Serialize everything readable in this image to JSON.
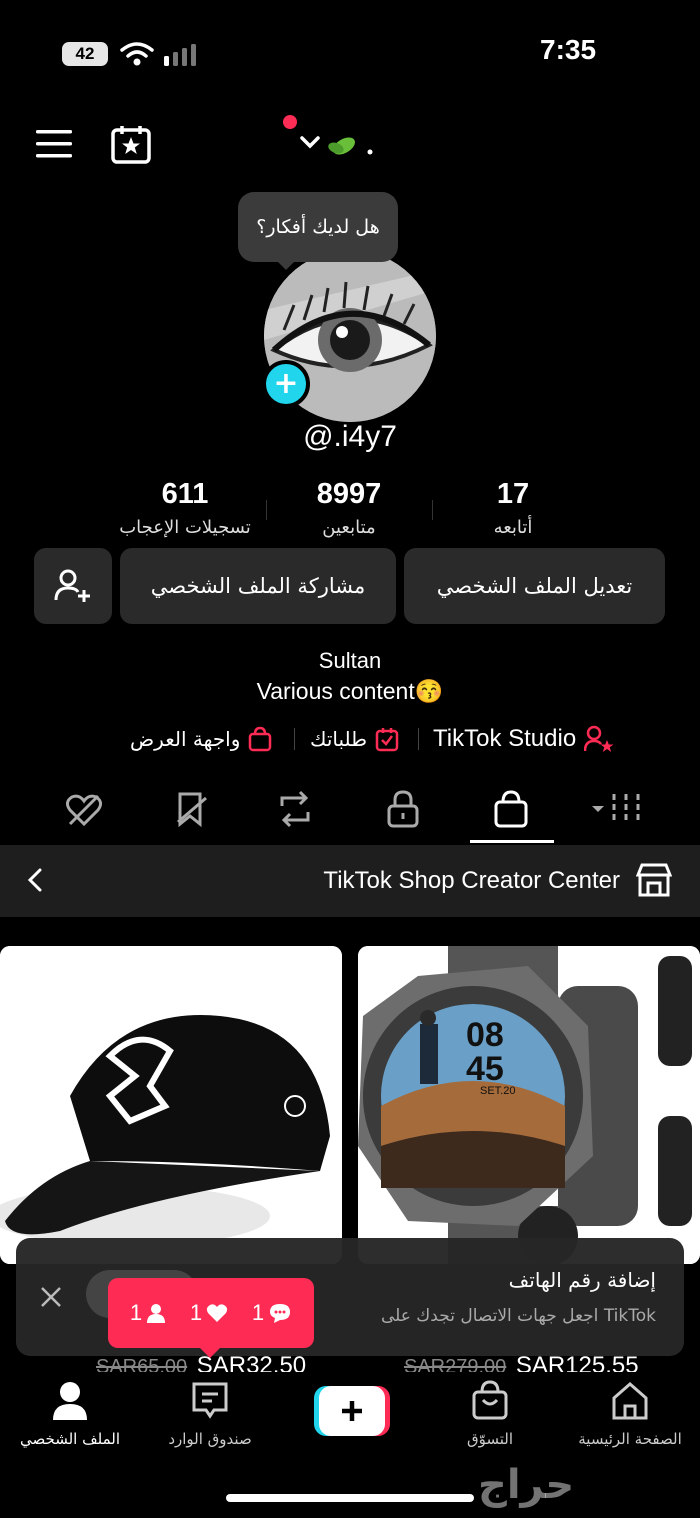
{
  "status_bar": {
    "time": "7:35",
    "battery": "42"
  },
  "profile": {
    "username_menu_label": "",
    "tooltip": "هل لديك أفكار؟",
    "handle": "@.i4y7",
    "stats": [
      {
        "value": "611",
        "label": "تسجيلات الإعجاب"
      },
      {
        "value": "8997",
        "label": "متابعين"
      },
      {
        "value": "17",
        "label": "أتابعه"
      }
    ],
    "buttons": {
      "share": "مشاركة الملف الشخصي",
      "edit": "تعديل الملف الشخصي"
    },
    "bio": {
      "name": "Sultan",
      "line2": "Various content😚"
    },
    "links": {
      "storefront": "واجهة العرض",
      "orders": "طلباتك",
      "studio": "TikTok Studio"
    }
  },
  "tabs": [
    "liked-hidden",
    "favorites",
    "reposts",
    "private",
    "shop",
    "videos"
  ],
  "shop": {
    "title": "TikTok Shop Creator Center",
    "watch_face": {
      "hour": "08",
      "minute": "45",
      "date": "SET.20"
    },
    "products": [
      {
        "old_price": "SAR65.00",
        "price": "SAR32.50"
      },
      {
        "old_price": "SAR279.00",
        "price": "SAR125.55"
      }
    ]
  },
  "toast": {
    "title": "إضافة رقم الهاتف",
    "subtitle": "اجعل جهات الاتصال تجدك على TikTok"
  },
  "notifications": {
    "followers": "1",
    "likes": "1",
    "comments": "1"
  },
  "nav": {
    "profile": "الملف الشخصي",
    "inbox": "صندوق الوارد",
    "shop": "التسوّق",
    "home": "الصفحة الرئيسية"
  },
  "watermark": "حراج",
  "colors": {
    "accent": "#fe2c55",
    "cyan": "#20d5ec",
    "background": "#000000"
  }
}
